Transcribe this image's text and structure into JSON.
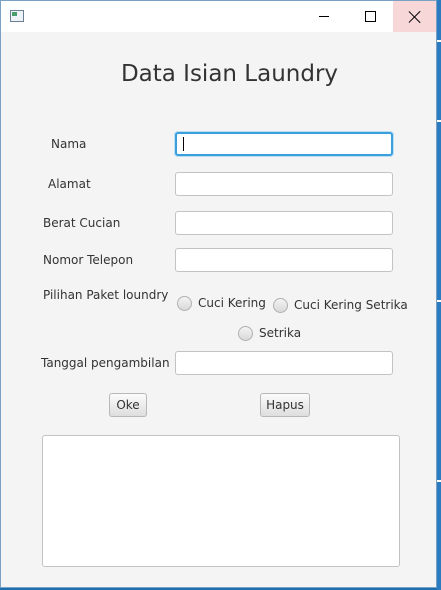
{
  "window": {
    "title": "",
    "icons": {
      "app": "app-icon",
      "minimize": "minimize-icon",
      "maximize": "maximize-icon",
      "close": "close-icon"
    }
  },
  "form": {
    "heading": "Data Isian Laundry",
    "labels": {
      "nama": "Nama",
      "alamat": "Alamat",
      "berat": "Berat Cucian",
      "telepon": "Nomor Telepon",
      "paket": "Pilihan Paket loundry",
      "tanggal": "Tanggal pengambilan"
    },
    "values": {
      "nama": "",
      "alamat": "",
      "berat": "",
      "telepon": "",
      "tanggal": ""
    },
    "radio_options": [
      "Cuci Kering",
      "Cuci Kering Setrika",
      "Setrika"
    ],
    "buttons": {
      "ok": "Oke",
      "delete": "Hapus"
    },
    "output_text": ""
  },
  "colors": {
    "focus": "#3aa0dc",
    "close_hover": "#f8d7d9"
  }
}
